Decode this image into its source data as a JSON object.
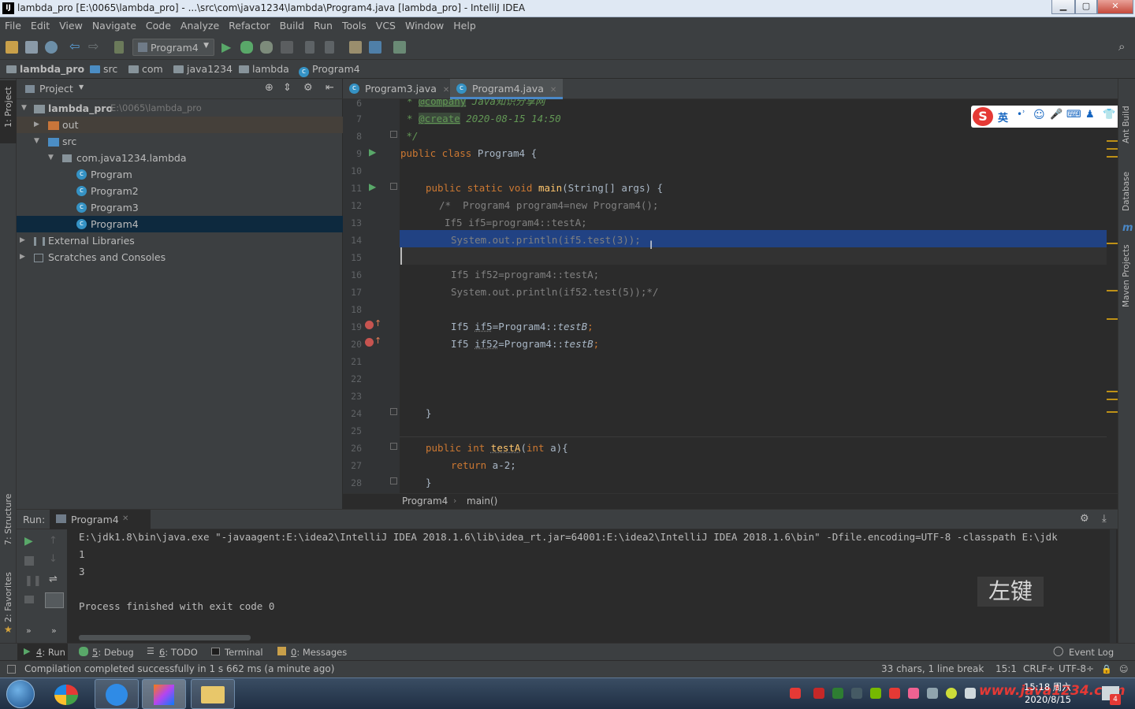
{
  "window": {
    "title": "lambda_pro [E:\\0065\\lambda_pro] - ...\\src\\com\\java1234\\lambda\\Program4.java [lambda_pro] - IntelliJ IDEA",
    "app_icon": "IJ",
    "minimize": "▁",
    "maximize": "▢",
    "close": "✕"
  },
  "menu": [
    "File",
    "Edit",
    "View",
    "Navigate",
    "Code",
    "Analyze",
    "Refactor",
    "Build",
    "Run",
    "Tools",
    "VCS",
    "Window",
    "Help"
  ],
  "toolbar": {
    "run_config": "Program4"
  },
  "breadcrumb": [
    "lambda_pro",
    "src",
    "com",
    "java1234",
    "lambda",
    "Program4"
  ],
  "left_stripe": {
    "project": "1: Project",
    "structure": "7: Structure",
    "favorites": "2: Favorites"
  },
  "right_stripe": {
    "ant": "Ant Build",
    "database": "Database",
    "maven": "Maven Projects",
    "maven_icon": "m"
  },
  "project_panel": {
    "title": "Project",
    "tree": [
      {
        "label": "lambda_pro",
        "path": "E:\\0065\\lambda_pro"
      },
      {
        "label": "out"
      },
      {
        "label": "src"
      },
      {
        "label": "com.java1234.lambda"
      },
      {
        "label": "Program"
      },
      {
        "label": "Program2"
      },
      {
        "label": "Program3"
      },
      {
        "label": "Program4"
      },
      {
        "label": "External Libraries"
      },
      {
        "label": "Scratches and Consoles"
      }
    ]
  },
  "tabs": [
    "Program3.java",
    "Program4.java"
  ],
  "editor": {
    "line_numbers": [
      "6",
      "7",
      "8",
      "9",
      "10",
      "11",
      "12",
      "13",
      "14",
      "15",
      "16",
      "17",
      "18",
      "19",
      "20",
      "21",
      "22",
      "23",
      "24",
      "25",
      "26",
      "27",
      "28"
    ],
    "lines": {
      "l6_tag": "@company",
      "l6_text": " Java知识分享网",
      "l7_tag": "@create",
      "l7_text": " 2020-08-15 14:50",
      "l8": " */",
      "l9_kw": "public class",
      "l9_rest": " Program4 {",
      "l11_kw": "public static void",
      "l11_fn": "main",
      "l11_rest": "(String[] args) {",
      "l12": "/*  Program4 program4=new Program4();",
      "l13": "If5 if5=program4::testA;",
      "l14": "System.out.println(if5.test(3));",
      "l16": "If5 if52=program4::testA;",
      "l17": "System.out.println(if52.test(5));*/",
      "l19_a": "If5 ",
      "l19_b": "if5",
      "l19_c": "=Program4::",
      "l19_d": "testB",
      "l19_e": ";",
      "l20_a": "If5 ",
      "l20_b": "if52",
      "l20_c": "=Program4::",
      "l20_d": "testB",
      "l20_e": ";",
      "l24": "}",
      "l26_kw": "public int",
      "l26_fn": "testA",
      "l26_kw2": "int",
      "l26_rest": " a){",
      "l27_kw": "return",
      "l27_rest": " a-2;",
      "l28": "}"
    },
    "breadcrumb": [
      "Program4",
      "main()"
    ]
  },
  "run_panel": {
    "label": "Run:",
    "tab": "Program4",
    "console": [
      "E:\\jdk1.8\\bin\\java.exe \"-javaagent:E:\\idea2\\IntelliJ IDEA 2018.1.6\\lib\\idea_rt.jar=64001:E:\\idea2\\IntelliJ IDEA 2018.1.6\\bin\" -Dfile.encoding=UTF-8 -classpath E:\\jdk",
      "1",
      "3",
      "",
      "Process finished with exit code 0"
    ],
    "overlay": "左键"
  },
  "bottom_tools": [
    {
      "num": "4",
      "label": ": Run"
    },
    {
      "num": "5",
      "label": ": Debug"
    },
    {
      "num": "6",
      "label": ": TODO"
    },
    {
      "num": "",
      "label": "Terminal"
    },
    {
      "num": "0",
      "label": ": Messages"
    }
  ],
  "event_log": "Event Log",
  "status": {
    "message": "Compilation completed successfully in 1 s 662 ms (a minute ago)",
    "selection": "33 chars, 1 line break",
    "position": "15:1",
    "line_sep": "CRLF÷",
    "encoding": "UTF-8÷"
  },
  "ime": {
    "lang": "英"
  },
  "taskbar": {
    "time": "15:18 周六",
    "date": "2020/8/15",
    "watermark": "www.java1234.com",
    "badge": "4"
  },
  "colors": {
    "accent": "#4a88c7",
    "selection": "#214283",
    "keyword": "#cc7832",
    "string_doc": "#629755",
    "method": "#ffc66d",
    "run_green": "#59a869"
  }
}
